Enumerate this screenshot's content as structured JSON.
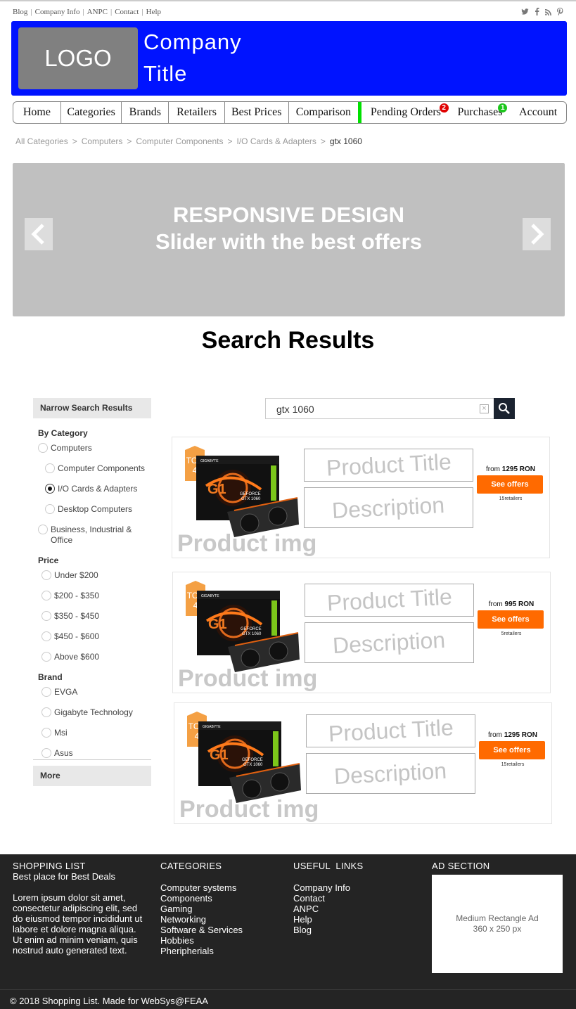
{
  "top_links": [
    "Blog",
    "Company Info",
    "ANPC",
    "Contact",
    "Help"
  ],
  "social_icons": [
    "twitter-icon",
    "facebook-icon",
    "rss-icon",
    "pinterest-icon"
  ],
  "header": {
    "logo": "LOGO",
    "company_line1": "Company",
    "company_line2": "Title",
    "background": "#0013ff"
  },
  "nav": {
    "home": "Home",
    "categories": "Categories",
    "brands": "Brands",
    "retailers": "Retailers",
    "best_prices": "Best Prices",
    "comparison": "Comparison",
    "pending_orders": "Pending Orders",
    "pending_badge": "2",
    "purchases": "Purchases",
    "purchases_badge": "1",
    "account": "Account"
  },
  "breadcrumb": {
    "items": [
      "All Categories",
      "Computers",
      "Computer Components",
      "I/O Cards & Adapters"
    ],
    "current": "gtx 1060"
  },
  "slider": {
    "line1": "RESPONSIVE DESIGN",
    "line2": "Slider with the best offers",
    "prev": "<",
    "next": ">"
  },
  "section_title": "Search Results",
  "sidebar": {
    "heading": "Narrow Search Results",
    "by_category": "By Category",
    "categories": [
      "Computers",
      "Computer Components",
      "I/O Cards & Adapters",
      "Desktop Computers",
      "Business, Industrial & Office"
    ],
    "price": "Price",
    "prices": [
      "Under $200",
      "$200 - $350",
      "$350 - $450",
      "$450 - $600",
      "Above $600"
    ],
    "brand": "Brand",
    "brands": [
      "EVGA",
      "Gigabyte Technology",
      "Msi",
      "Asus"
    ],
    "more": "More"
  },
  "search": {
    "value": "gtx 1060"
  },
  "products": [
    {
      "tag_top": "TOP",
      "tag_num": "4",
      "img_label": "Product img",
      "title": "Product Title",
      "description": "Description",
      "price_prefix": "from",
      "price": "1295 RON",
      "button": "See offers",
      "retailers": "15retailers"
    },
    {
      "tag_top": "TOP",
      "tag_num": "4",
      "img_label": "Product img",
      "title": "Product Title",
      "description": "Description",
      "price_prefix": "from",
      "price": "995 RON",
      "button": "See offers",
      "retailers": "5retailers"
    },
    {
      "tag_top": "TOP",
      "tag_num": "4",
      "img_label": "Product img",
      "title": "Product Title",
      "description": "Description",
      "price_prefix": "from",
      "price": "1295 RON",
      "button": "See offers",
      "retailers": "15retailers"
    }
  ],
  "footer": {
    "shopping_list": "SHOPPING LIST",
    "tagline": "Best place for Best Deals",
    "lorem": "Lorem ipsum dolor sit amet, consectetur adipiscing elit, sed do eiusmod tempor incididunt ut labore et dolore magna aliqua. Ut enim ad minim veniam, quis nostrud auto generated text.",
    "categories_head": "CATEGORIES",
    "categories": [
      "Computer systems",
      "Components",
      "Gaming",
      "Networking",
      "Software & Services",
      "Hobbies",
      "Pheripherials"
    ],
    "links_head": "USEFUL  LINKS",
    "links": [
      "Company Info",
      "Contact",
      "ANPC",
      "Help",
      "Blog"
    ],
    "ad_head": "AD SECTION",
    "ad_line1": "Medium Rectangle Ad",
    "ad_line2": "360 x 250 px",
    "copyright": "© 2018 Shopping List. Made for WebSys@FEAA"
  }
}
